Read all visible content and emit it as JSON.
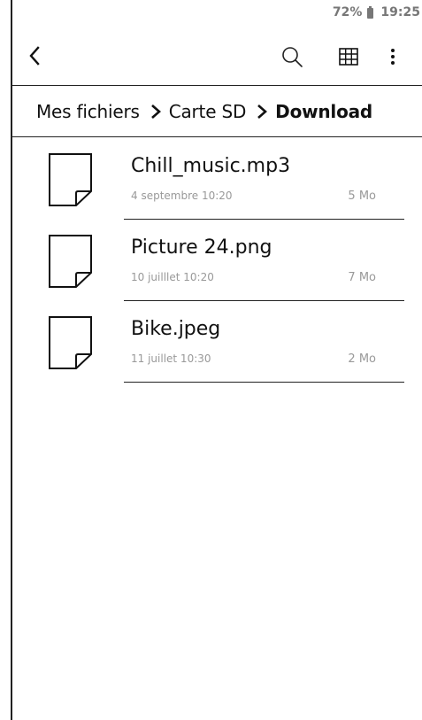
{
  "status_bar": {
    "battery_percent": "72%",
    "time": "19:25",
    "battery_icon": "battery-icon"
  },
  "toolbar": {
    "back_icon": "chevron-left-icon",
    "search_icon": "search-icon",
    "view_icon": "grid-view-icon",
    "more_icon": "more-vertical-icon"
  },
  "breadcrumb": {
    "items": [
      {
        "label": "Mes fichiers"
      },
      {
        "label": "Carte SD"
      },
      {
        "label": "Download"
      }
    ],
    "separator_icon": "chevron-right-icon"
  },
  "files": [
    {
      "name": "Chill_music.mp3",
      "date": "4 septembre 10:20",
      "size": "5 Mo",
      "icon": "file-icon"
    },
    {
      "name": "Picture 24.png",
      "date": "10 juilllet 10:20",
      "size": "7 Mo",
      "icon": "file-icon"
    },
    {
      "name": "Bike.jpeg",
      "date": "11 juillet 10:30",
      "size": "2 Mo",
      "icon": "file-icon"
    }
  ],
  "colors": {
    "text": "#111111",
    "muted": "#999999",
    "status": "#777777",
    "border": "#222222",
    "background": "#ffffff"
  }
}
